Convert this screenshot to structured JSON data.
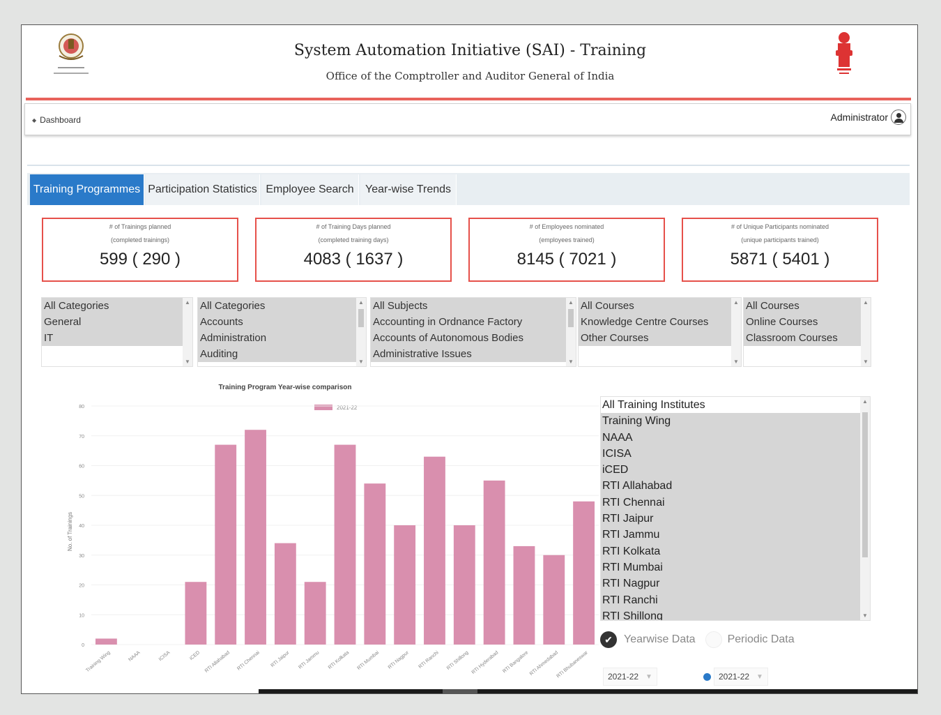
{
  "header": {
    "title": "System Automation Initiative (SAI) - Training",
    "subtitle": "Office of the Comptroller and Auditor General of India"
  },
  "breadcrumb": {
    "label": "Dashboard"
  },
  "user": {
    "name": "Administrator"
  },
  "tabs": [
    {
      "label": "Training Programmes",
      "active": true
    },
    {
      "label": "Participation Statistics",
      "active": false
    },
    {
      "label": "Employee Search",
      "active": false
    },
    {
      "label": "Year-wise Trends",
      "active": false
    }
  ],
  "stats": [
    {
      "line1": "# of Trainings planned",
      "line2": "(completed trainings)",
      "value": "599 ( 290 )"
    },
    {
      "line1": "# of Training Days planned",
      "line2": "(completed training days)",
      "value": "4083 ( 1637 )"
    },
    {
      "line1": "# of Employees nominated",
      "line2": "(employees trained)",
      "value": "8145 ( 7021 )"
    },
    {
      "line1": "# of Unique Participants nominated",
      "line2": "(unique participants trained)",
      "value": "5871 ( 5401 )"
    }
  ],
  "filters": {
    "category": [
      "All Categories",
      "General",
      "IT"
    ],
    "subcategory": [
      "All Categories",
      "Accounts",
      "Administration",
      "Auditing"
    ],
    "subject": [
      "All Subjects",
      "Accounting in Ordnance Factory",
      "Accounts of Autonomous Bodies",
      "Administrative Issues"
    ],
    "course_type": [
      "All Courses",
      "Knowledge Centre Courses",
      "Other Courses"
    ],
    "mode": [
      "All Courses",
      "Online Courses",
      "Classroom Courses"
    ]
  },
  "institutes": [
    "All Training Institutes",
    "Training Wing",
    "NAAA",
    "ICISA",
    "iCED",
    "RTI Allahabad",
    "RTI Chennai",
    "RTI Jaipur",
    "RTI Jammu",
    "RTI Kolkata",
    "RTI Mumbai",
    "RTI Nagpur",
    "RTI Ranchi",
    "RTI Shillong"
  ],
  "radios": {
    "yearwise": "Yearwise Data",
    "periodic": "Periodic Data"
  },
  "selects": {
    "from": "2021-22",
    "to": "2021-22"
  },
  "colors": {
    "accent": "#2a7ac9",
    "bar": "#d98fae",
    "stat_border": "#e6504a",
    "header_rule": "#e8625b"
  },
  "chart_data": {
    "type": "bar",
    "title": "Training Program Year-wise comparison",
    "ylabel": "No. of Trainings",
    "ylim": [
      0,
      80
    ],
    "yticks": [
      0,
      10,
      20,
      30,
      40,
      50,
      60,
      70,
      80
    ],
    "categories": [
      "Training Wing",
      "NAAA",
      "ICISA",
      "iCED",
      "RTI Allahabad",
      "RTI Chennai",
      "RTI Jaipur",
      "RTI Jammu",
      "RTI Kolkata",
      "RTI Mumbai",
      "RTI Nagpur",
      "RTI Ranchi",
      "RTI Shillong",
      "RTI Hyderabad",
      "RTI Bangalore",
      "RTI Ahmedabad",
      "RTI Bhubaneswar"
    ],
    "series": [
      {
        "name": "2021-22",
        "values": [
          2,
          0,
          0,
          21,
          67,
          72,
          34,
          21,
          67,
          54,
          40,
          63,
          40,
          55,
          33,
          30,
          48
        ]
      }
    ]
  }
}
